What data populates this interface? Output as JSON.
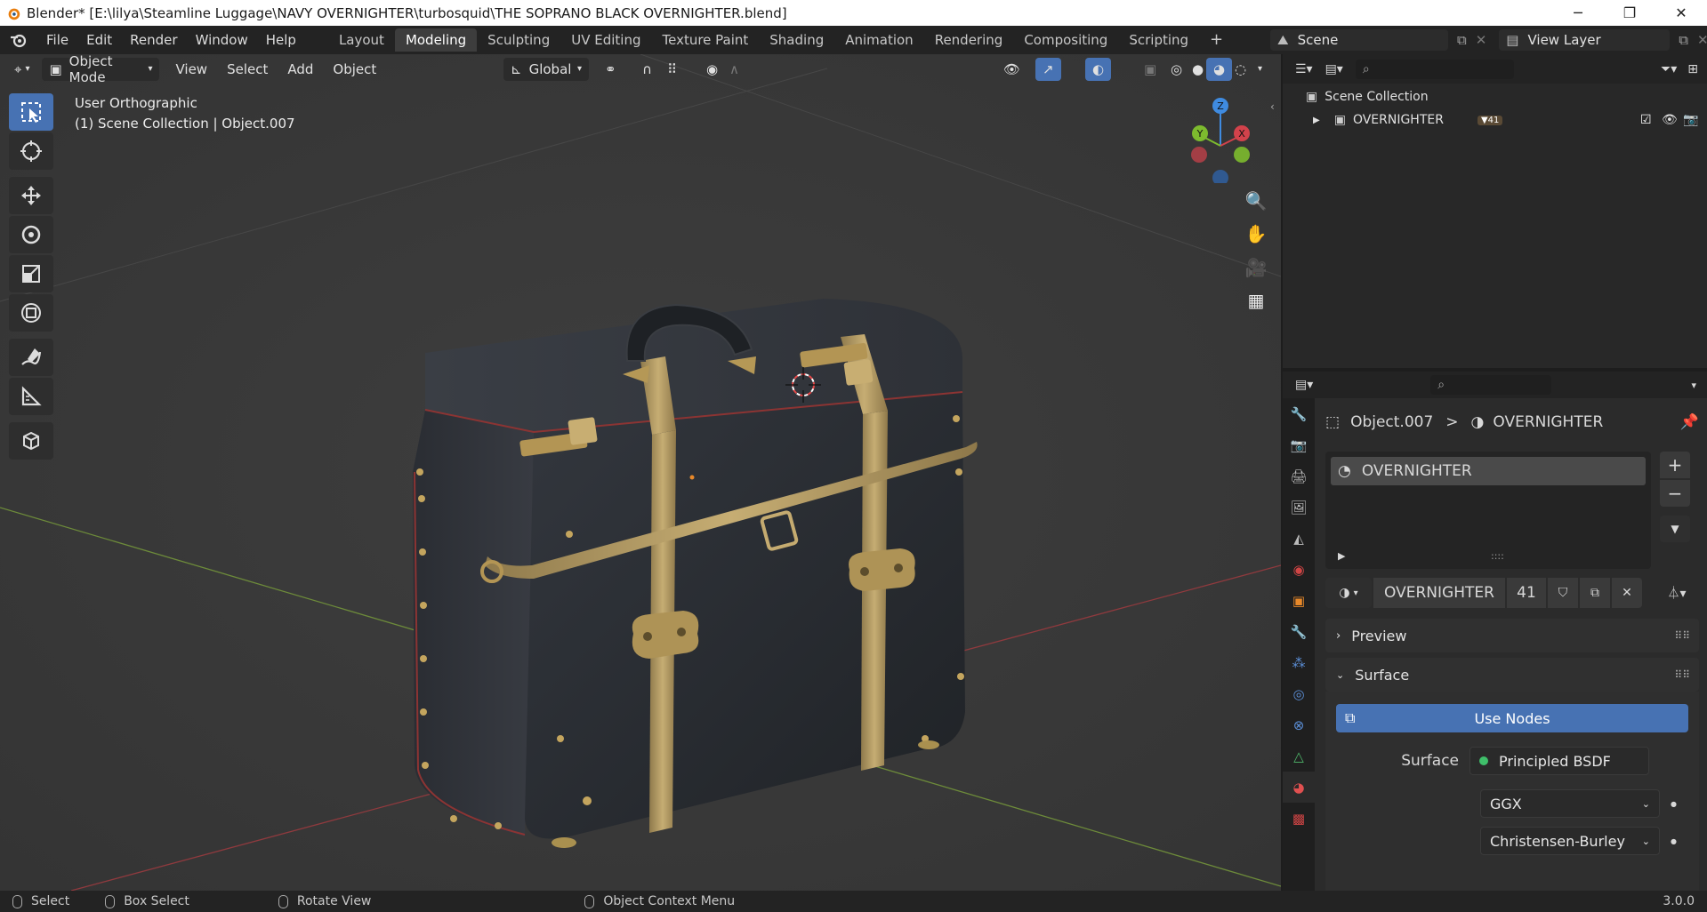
{
  "window": {
    "title": "Blender* [E:\\lilya\\Steamline Luggage\\NAVY OVERNIGHTER\\turbosquid\\THE SOPRANO BLACK OVERNIGHTER.blend]",
    "minimize": "─",
    "restore": "❐",
    "close": "✕"
  },
  "menu": {
    "items": [
      "File",
      "Edit",
      "Render",
      "Window",
      "Help"
    ]
  },
  "workspaces": {
    "tabs": [
      "Layout",
      "Modeling",
      "Sculpting",
      "UV Editing",
      "Texture Paint",
      "Shading",
      "Animation",
      "Rendering",
      "Compositing",
      "Scripting"
    ],
    "active": "Modeling",
    "add": "+"
  },
  "scene": {
    "label": "Scene",
    "view_layer": "View Layer"
  },
  "viewport": {
    "mode": "Object Mode",
    "menus": [
      "View",
      "Select",
      "Add",
      "Object"
    ],
    "transform_orientation": "Global",
    "view_name": "User Orthographic",
    "collection_info": "(1) Scene Collection | Object.007",
    "axes": {
      "x": "X",
      "y": "Y",
      "z": "Z"
    }
  },
  "outliner": {
    "root": "Scene Collection",
    "collection": "OVERNIGHTER",
    "badge": "41"
  },
  "properties": {
    "breadcrumb_object": "Object.007",
    "breadcrumb_separator": ">",
    "breadcrumb_material": "OVERNIGHTER",
    "slot_name": "OVERNIGHTER",
    "material_name": "OVERNIGHTER",
    "user_count": "41",
    "sections": {
      "preview": "Preview",
      "surface": "Surface"
    },
    "use_nodes": "Use Nodes",
    "surface_label": "Surface",
    "surface_value": "Principled BSDF",
    "distribution": "GGX",
    "subsurface": "Christensen-Burley",
    "handle": "::::"
  },
  "statusbar": {
    "select": "Select",
    "box_select": "Box Select",
    "rotate_view": "Rotate View",
    "context_menu": "Object Context Menu",
    "version": "3.0.0"
  },
  "colors": {
    "accent": "#4772b3",
    "x_axis": "#d2424b",
    "y_axis": "#7dbb2e",
    "z_axis": "#3f8be0",
    "brass": "#b49a62",
    "leather": "#2a2d33"
  }
}
